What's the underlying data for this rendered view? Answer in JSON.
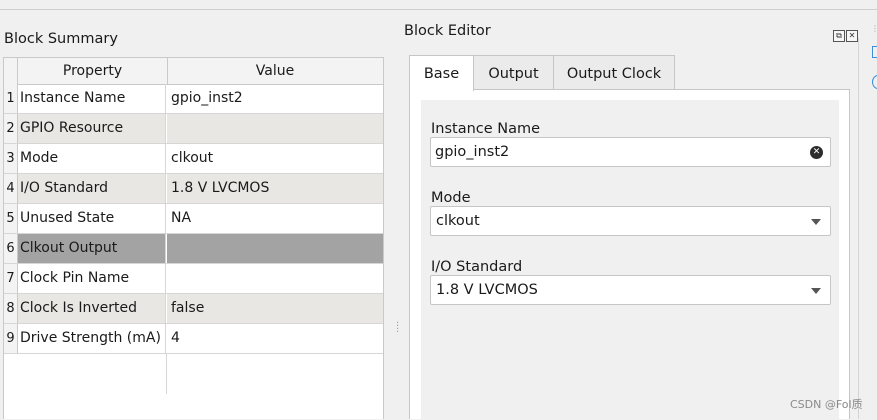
{
  "block_summary": {
    "title": "Block Summary",
    "columns": [
      "Property",
      "Value"
    ],
    "rows": [
      {
        "num": "1",
        "property": "Instance Name",
        "value": "gpio_inst2"
      },
      {
        "num": "2",
        "property": "GPIO Resource",
        "value": ""
      },
      {
        "num": "3",
        "property": "Mode",
        "value": "clkout"
      },
      {
        "num": "4",
        "property": "I/O Standard",
        "value": "1.8 V LVCMOS"
      },
      {
        "num": "5",
        "property": "Unused State",
        "value": "NA"
      },
      {
        "num": "6",
        "property": "Clkout Output",
        "value": ""
      },
      {
        "num": "7",
        "property": "Clock Pin Name",
        "value": ""
      },
      {
        "num": "8",
        "property": "Clock Is Inverted",
        "value": "false"
      },
      {
        "num": "9",
        "property": "Drive Strength (mA)",
        "value": "4"
      }
    ]
  },
  "block_editor": {
    "title": "Block Editor",
    "tabs": [
      {
        "label": "Base",
        "active": true
      },
      {
        "label": "Output",
        "active": false
      },
      {
        "label": "Output Clock",
        "active": false
      }
    ],
    "fields": {
      "instance_name": {
        "label": "Instance Name",
        "value": "gpio_inst2"
      },
      "mode": {
        "label": "Mode",
        "value": "clkout"
      },
      "io_standard": {
        "label": "I/O Standard",
        "value": "1.8 V LVCMOS"
      }
    }
  },
  "icons": {
    "float": "float-icon",
    "close": "close-icon",
    "clear": "clear-icon",
    "dropdown": "chevron-down-icon"
  },
  "colors": {
    "selected_row": "#a3a3a3",
    "alt_row": "#e9e7e4",
    "accent": "#3c8fd8"
  },
  "watermark": "CSDN @Fol质"
}
